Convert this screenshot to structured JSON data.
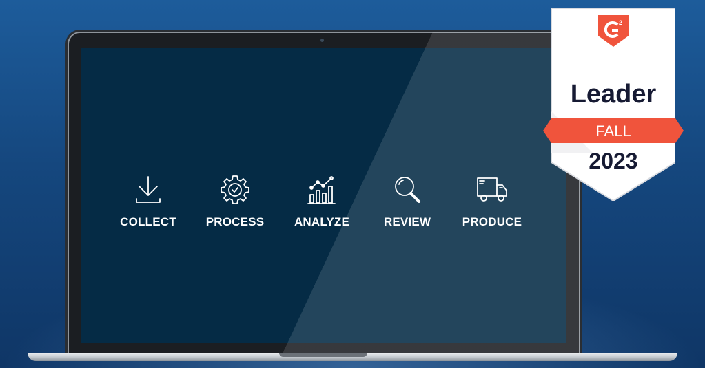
{
  "steps": [
    {
      "label": "COLLECT",
      "icon": "download-icon"
    },
    {
      "label": "PROCESS",
      "icon": "gear-check-icon"
    },
    {
      "label": "ANALYZE",
      "icon": "bar-chart-trend-icon"
    },
    {
      "label": "REVIEW",
      "icon": "magnifier-icon"
    },
    {
      "label": "PRODUCE",
      "icon": "delivery-truck-icon"
    }
  ],
  "badge": {
    "logo": "G2",
    "logo_icon": "g2-logo-icon",
    "title": "Leader",
    "season": "FALL",
    "year": "2023"
  },
  "colors": {
    "background": "#15477e",
    "screen": "#052b45",
    "badge_accent": "#f0543c",
    "badge_text": "#161a33"
  }
}
